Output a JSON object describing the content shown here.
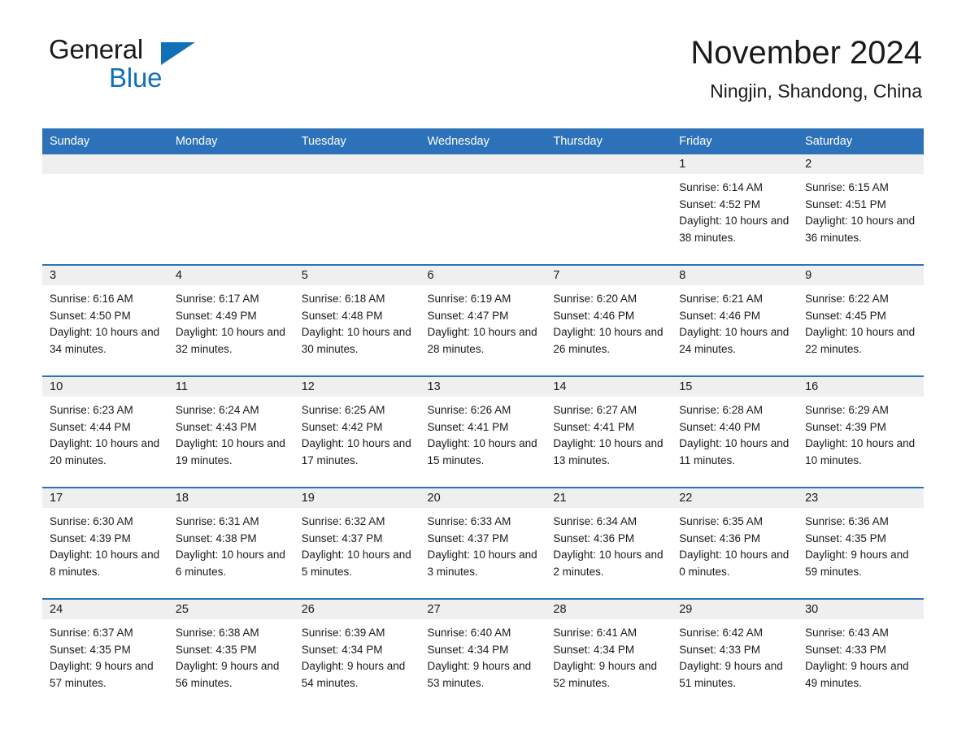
{
  "brand": {
    "name_part1": "General",
    "name_part2": "Blue"
  },
  "header": {
    "title": "November 2024",
    "location": "Ningjin, Shandong, China"
  },
  "weekday_headers": [
    "Sunday",
    "Monday",
    "Tuesday",
    "Wednesday",
    "Thursday",
    "Friday",
    "Saturday"
  ],
  "colors": {
    "header_blue": "#2d72b8",
    "brand_blue": "#1070b8",
    "daynum_band": "#efefef",
    "text": "#1a1a1a"
  },
  "weeks": [
    [
      {
        "empty": true
      },
      {
        "empty": true
      },
      {
        "empty": true
      },
      {
        "empty": true
      },
      {
        "empty": true
      },
      {
        "day": "1",
        "sunrise": "Sunrise: 6:14 AM",
        "sunset": "Sunset: 4:52 PM",
        "daylight": "Daylight: 10 hours and 38 minutes."
      },
      {
        "day": "2",
        "sunrise": "Sunrise: 6:15 AM",
        "sunset": "Sunset: 4:51 PM",
        "daylight": "Daylight: 10 hours and 36 minutes."
      }
    ],
    [
      {
        "day": "3",
        "sunrise": "Sunrise: 6:16 AM",
        "sunset": "Sunset: 4:50 PM",
        "daylight": "Daylight: 10 hours and 34 minutes."
      },
      {
        "day": "4",
        "sunrise": "Sunrise: 6:17 AM",
        "sunset": "Sunset: 4:49 PM",
        "daylight": "Daylight: 10 hours and 32 minutes."
      },
      {
        "day": "5",
        "sunrise": "Sunrise: 6:18 AM",
        "sunset": "Sunset: 4:48 PM",
        "daylight": "Daylight: 10 hours and 30 minutes."
      },
      {
        "day": "6",
        "sunrise": "Sunrise: 6:19 AM",
        "sunset": "Sunset: 4:47 PM",
        "daylight": "Daylight: 10 hours and 28 minutes."
      },
      {
        "day": "7",
        "sunrise": "Sunrise: 6:20 AM",
        "sunset": "Sunset: 4:46 PM",
        "daylight": "Daylight: 10 hours and 26 minutes."
      },
      {
        "day": "8",
        "sunrise": "Sunrise: 6:21 AM",
        "sunset": "Sunset: 4:46 PM",
        "daylight": "Daylight: 10 hours and 24 minutes."
      },
      {
        "day": "9",
        "sunrise": "Sunrise: 6:22 AM",
        "sunset": "Sunset: 4:45 PM",
        "daylight": "Daylight: 10 hours and 22 minutes."
      }
    ],
    [
      {
        "day": "10",
        "sunrise": "Sunrise: 6:23 AM",
        "sunset": "Sunset: 4:44 PM",
        "daylight": "Daylight: 10 hours and 20 minutes."
      },
      {
        "day": "11",
        "sunrise": "Sunrise: 6:24 AM",
        "sunset": "Sunset: 4:43 PM",
        "daylight": "Daylight: 10 hours and 19 minutes."
      },
      {
        "day": "12",
        "sunrise": "Sunrise: 6:25 AM",
        "sunset": "Sunset: 4:42 PM",
        "daylight": "Daylight: 10 hours and 17 minutes."
      },
      {
        "day": "13",
        "sunrise": "Sunrise: 6:26 AM",
        "sunset": "Sunset: 4:41 PM",
        "daylight": "Daylight: 10 hours and 15 minutes."
      },
      {
        "day": "14",
        "sunrise": "Sunrise: 6:27 AM",
        "sunset": "Sunset: 4:41 PM",
        "daylight": "Daylight: 10 hours and 13 minutes."
      },
      {
        "day": "15",
        "sunrise": "Sunrise: 6:28 AM",
        "sunset": "Sunset: 4:40 PM",
        "daylight": "Daylight: 10 hours and 11 minutes."
      },
      {
        "day": "16",
        "sunrise": "Sunrise: 6:29 AM",
        "sunset": "Sunset: 4:39 PM",
        "daylight": "Daylight: 10 hours and 10 minutes."
      }
    ],
    [
      {
        "day": "17",
        "sunrise": "Sunrise: 6:30 AM",
        "sunset": "Sunset: 4:39 PM",
        "daylight": "Daylight: 10 hours and 8 minutes."
      },
      {
        "day": "18",
        "sunrise": "Sunrise: 6:31 AM",
        "sunset": "Sunset: 4:38 PM",
        "daylight": "Daylight: 10 hours and 6 minutes."
      },
      {
        "day": "19",
        "sunrise": "Sunrise: 6:32 AM",
        "sunset": "Sunset: 4:37 PM",
        "daylight": "Daylight: 10 hours and 5 minutes."
      },
      {
        "day": "20",
        "sunrise": "Sunrise: 6:33 AM",
        "sunset": "Sunset: 4:37 PM",
        "daylight": "Daylight: 10 hours and 3 minutes."
      },
      {
        "day": "21",
        "sunrise": "Sunrise: 6:34 AM",
        "sunset": "Sunset: 4:36 PM",
        "daylight": "Daylight: 10 hours and 2 minutes."
      },
      {
        "day": "22",
        "sunrise": "Sunrise: 6:35 AM",
        "sunset": "Sunset: 4:36 PM",
        "daylight": "Daylight: 10 hours and 0 minutes."
      },
      {
        "day": "23",
        "sunrise": "Sunrise: 6:36 AM",
        "sunset": "Sunset: 4:35 PM",
        "daylight": "Daylight: 9 hours and 59 minutes."
      }
    ],
    [
      {
        "day": "24",
        "sunrise": "Sunrise: 6:37 AM",
        "sunset": "Sunset: 4:35 PM",
        "daylight": "Daylight: 9 hours and 57 minutes."
      },
      {
        "day": "25",
        "sunrise": "Sunrise: 6:38 AM",
        "sunset": "Sunset: 4:35 PM",
        "daylight": "Daylight: 9 hours and 56 minutes."
      },
      {
        "day": "26",
        "sunrise": "Sunrise: 6:39 AM",
        "sunset": "Sunset: 4:34 PM",
        "daylight": "Daylight: 9 hours and 54 minutes."
      },
      {
        "day": "27",
        "sunrise": "Sunrise: 6:40 AM",
        "sunset": "Sunset: 4:34 PM",
        "daylight": "Daylight: 9 hours and 53 minutes."
      },
      {
        "day": "28",
        "sunrise": "Sunrise: 6:41 AM",
        "sunset": "Sunset: 4:34 PM",
        "daylight": "Daylight: 9 hours and 52 minutes."
      },
      {
        "day": "29",
        "sunrise": "Sunrise: 6:42 AM",
        "sunset": "Sunset: 4:33 PM",
        "daylight": "Daylight: 9 hours and 51 minutes."
      },
      {
        "day": "30",
        "sunrise": "Sunrise: 6:43 AM",
        "sunset": "Sunset: 4:33 PM",
        "daylight": "Daylight: 9 hours and 49 minutes."
      }
    ]
  ]
}
